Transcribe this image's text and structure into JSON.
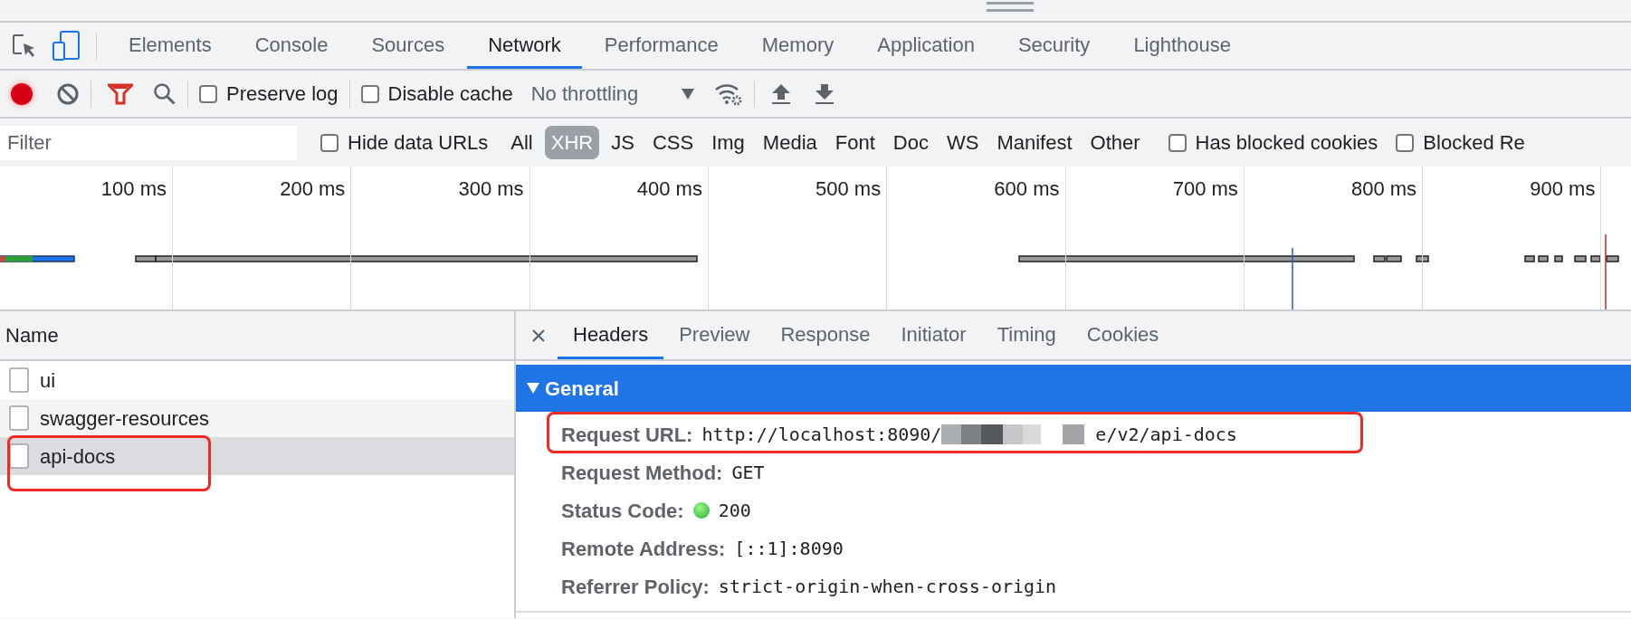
{
  "tabs": [
    {
      "label": "Elements",
      "selected": false
    },
    {
      "label": "Console",
      "selected": false
    },
    {
      "label": "Sources",
      "selected": false
    },
    {
      "label": "Network",
      "selected": true
    },
    {
      "label": "Performance",
      "selected": false
    },
    {
      "label": "Memory",
      "selected": false
    },
    {
      "label": "Application",
      "selected": false
    },
    {
      "label": "Security",
      "selected": false
    },
    {
      "label": "Lighthouse",
      "selected": false
    }
  ],
  "toolbar": {
    "recording": true,
    "preserve_log": {
      "label": "Preserve log",
      "checked": false
    },
    "disable_cache": {
      "label": "Disable cache",
      "checked": false
    },
    "throttling": "No throttling"
  },
  "filter": {
    "placeholder": "Filter",
    "hide_data_urls": {
      "label": "Hide data URLs",
      "checked": false
    },
    "types": [
      {
        "label": "All",
        "selected": false
      },
      {
        "label": "XHR",
        "selected": true
      },
      {
        "label": "JS",
        "selected": false
      },
      {
        "label": "CSS",
        "selected": false
      },
      {
        "label": "Img",
        "selected": false
      },
      {
        "label": "Media",
        "selected": false
      },
      {
        "label": "Font",
        "selected": false
      },
      {
        "label": "Doc",
        "selected": false
      },
      {
        "label": "WS",
        "selected": false
      },
      {
        "label": "Manifest",
        "selected": false
      },
      {
        "label": "Other",
        "selected": false
      }
    ],
    "has_blocked_cookies": {
      "label": "Has blocked cookies",
      "checked": false
    },
    "blocked_requests": {
      "label": "Blocked Re",
      "checked": false
    }
  },
  "timeline": {
    "ticks": [
      "100 ms",
      "200 ms",
      "300 ms",
      "400 ms",
      "500 ms",
      "600 ms",
      "700 ms",
      "800 ms",
      "900 ms"
    ]
  },
  "requests": {
    "header": "Name",
    "items": [
      {
        "name": "ui",
        "selected": false,
        "highlighted": false
      },
      {
        "name": "swagger-resources",
        "selected": false,
        "highlighted": false
      },
      {
        "name": "api-docs",
        "selected": true,
        "highlighted": true
      }
    ]
  },
  "details": {
    "tabs": [
      {
        "label": "Headers",
        "selected": true
      },
      {
        "label": "Preview",
        "selected": false
      },
      {
        "label": "Response",
        "selected": false
      },
      {
        "label": "Initiator",
        "selected": false
      },
      {
        "label": "Timing",
        "selected": false
      },
      {
        "label": "Cookies",
        "selected": false
      }
    ],
    "section": {
      "title": "General",
      "expanded": true
    },
    "rows": [
      {
        "kind": "url",
        "label": "Request URL:",
        "value": "http://localhost:8090/",
        "value_end": "e/v2/api-docs",
        "highlighted": true
      },
      {
        "kind": "plain",
        "label": "Request Method:",
        "value": "GET",
        "highlighted": false
      },
      {
        "kind": "status",
        "label": "Status Code:",
        "value": "200",
        "highlighted": false
      },
      {
        "kind": "plain",
        "label": "Remote Address:",
        "value": "[::1]:8090",
        "highlighted": false
      },
      {
        "kind": "plain",
        "label": "Referrer Policy:",
        "value": "strict-origin-when-cross-origin",
        "highlighted": false
      }
    ]
  }
}
